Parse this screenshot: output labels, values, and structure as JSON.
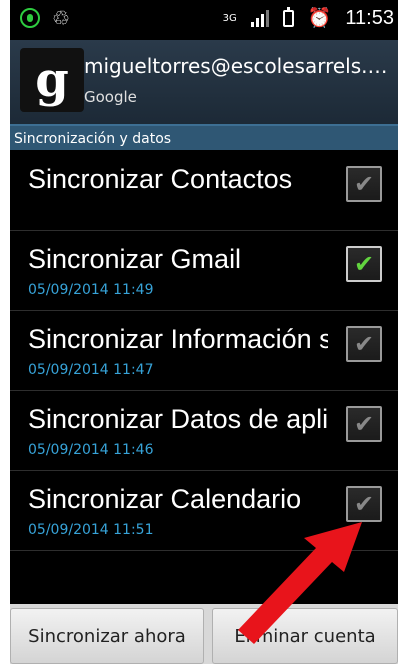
{
  "status_bar": {
    "network": "3G",
    "time": "11:53"
  },
  "account": {
    "email": "migueltorres@escolesarrels.c...",
    "type": "Google",
    "logo_letter": "g"
  },
  "section_title": "Sincronización y datos",
  "sync_items": [
    {
      "label": "Sincronizar Contactos",
      "date": "",
      "checked": false
    },
    {
      "label": "Sincronizar Gmail",
      "date": "05/09/2014 11:49",
      "checked": true
    },
    {
      "label": "Sincronizar Información s",
      "date": "05/09/2014 11:47",
      "checked": false
    },
    {
      "label": "Sincronizar Datos de apli",
      "date": "05/09/2014 11:46",
      "checked": false
    },
    {
      "label": "Sincronizar Calendario",
      "date": "05/09/2014 11:51",
      "checked": false
    }
  ],
  "buttons": {
    "sync_now": "Sincronizar ahora",
    "remove_account": "Eliminar cuenta"
  },
  "colors": {
    "section_header": "#2f5774",
    "date_text": "#37a3d8",
    "check_active": "#62d43f",
    "arrow": "#e8141b"
  }
}
